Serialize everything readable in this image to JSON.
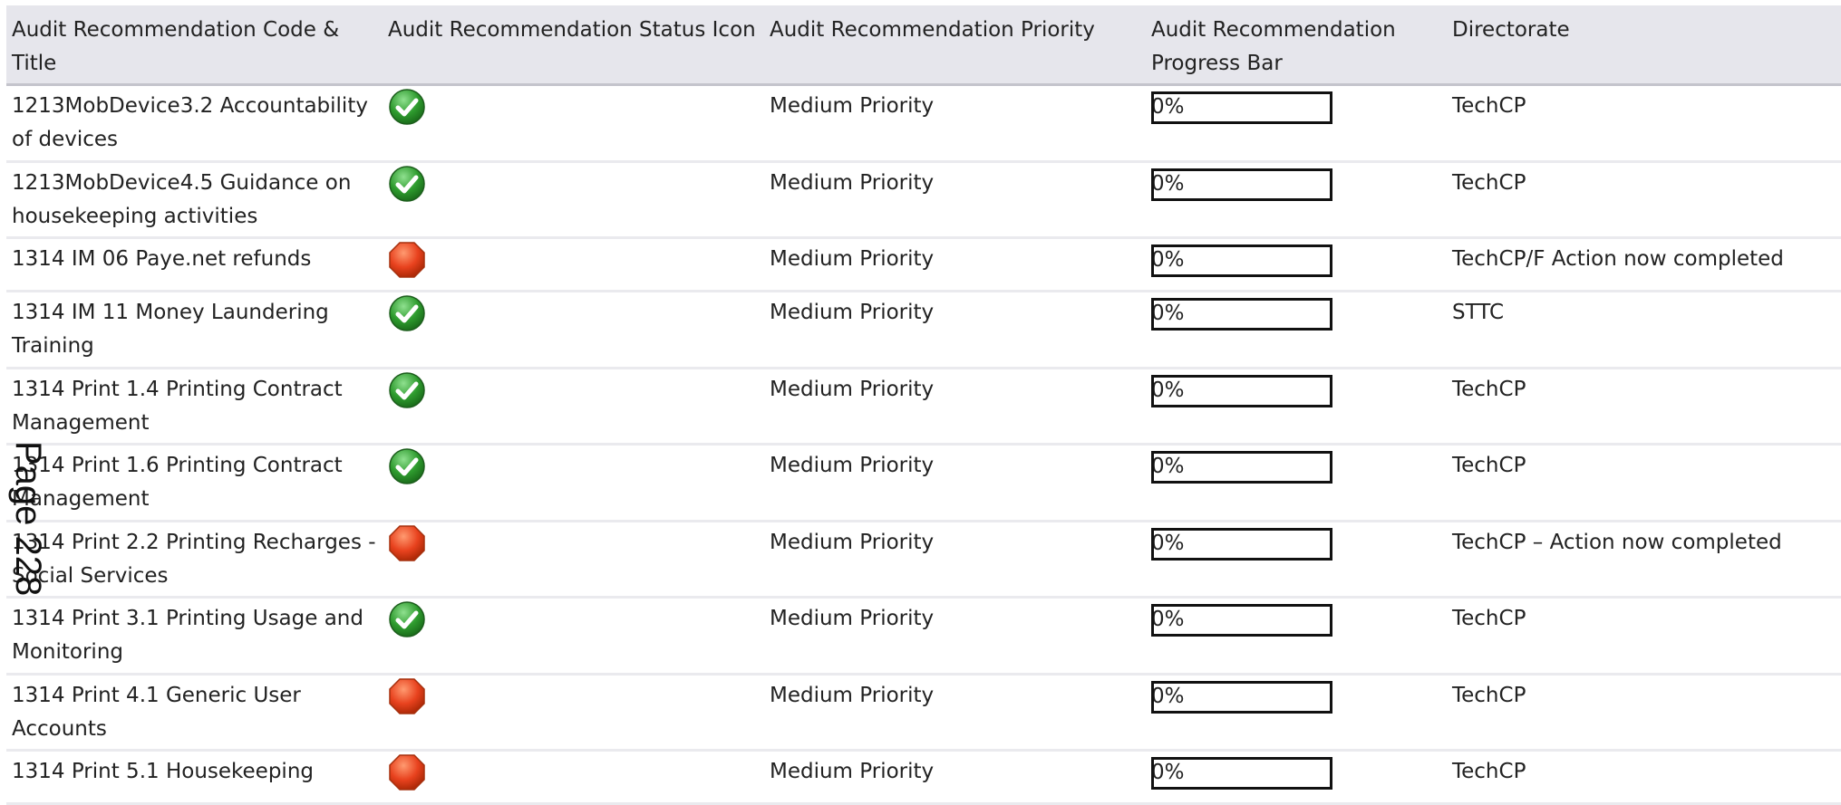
{
  "headers": {
    "code_title": "Audit Recommendation Code & Title",
    "status_icon": "Audit Recommendation Status Icon",
    "priority": "Audit Recommendation Priority",
    "progress": "Audit Recommendation Progress Bar",
    "directorate": "Directorate"
  },
  "colors": {
    "complete": "#2e9b2e",
    "incomplete": "#e8421e"
  },
  "rows": [
    {
      "code_title": "1213MobDevice3.2 Accountability of devices",
      "status": "check-icon",
      "priority": "Medium Priority",
      "progress": "0%",
      "progress_value": 0,
      "directorate": "TechCP"
    },
    {
      "code_title": "1213MobDevice4.5 Guidance on housekeeping activities",
      "status": "check-icon",
      "priority": "Medium Priority",
      "progress": "0%",
      "progress_value": 0,
      "directorate": "TechCP"
    },
    {
      "code_title": "1314 IM 06 Paye.net refunds",
      "status": "stop-icon",
      "priority": "Medium Priority",
      "progress": "0%",
      "progress_value": 0,
      "directorate": "TechCP/F Action now completed"
    },
    {
      "code_title": "1314 IM 11 Money Laundering Training",
      "status": "check-icon",
      "priority": "Medium Priority",
      "progress": "0%",
      "progress_value": 0,
      "directorate": "STTC"
    },
    {
      "code_title": "1314 Print 1.4 Printing Contract Management",
      "status": "check-icon",
      "priority": "Medium Priority",
      "progress": "0%",
      "progress_value": 0,
      "directorate": "TechCP"
    },
    {
      "code_title": "1314 Print 1.6 Printing Contract Management",
      "status": "check-icon",
      "priority": "Medium Priority",
      "progress": "0%",
      "progress_value": 0,
      "directorate": "TechCP"
    },
    {
      "code_title": "1314 Print 2.2 Printing Recharges - Social Services",
      "status": "stop-icon",
      "priority": "Medium Priority",
      "progress": "0%",
      "progress_value": 0,
      "directorate": "TechCP – Action now completed"
    },
    {
      "code_title": "1314 Print 3.1 Printing Usage and Monitoring",
      "status": "check-icon",
      "priority": "Medium Priority",
      "progress": "0%",
      "progress_value": 0,
      "directorate": "TechCP"
    },
    {
      "code_title": "1314 Print 4.1 Generic User Accounts",
      "status": "stop-icon",
      "priority": "Medium Priority",
      "progress": "0%",
      "progress_value": 0,
      "directorate": "TechCP"
    },
    {
      "code_title": "1314 Print 5.1 Housekeeping",
      "status": "stop-icon",
      "priority": "Medium Priority",
      "progress": "0%",
      "progress_value": 0,
      "directorate": "TechCP"
    }
  ],
  "page_label": "Page 228"
}
